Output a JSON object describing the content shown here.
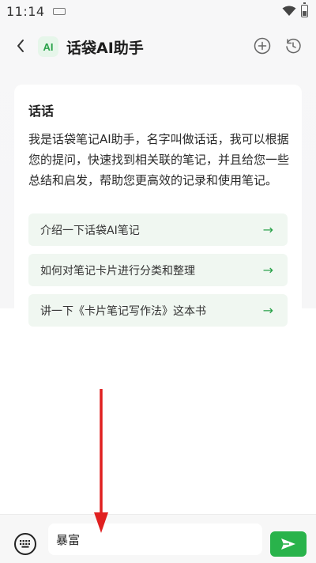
{
  "status_bar": {
    "time": "11:14"
  },
  "header": {
    "logo_text": "AI",
    "title": "话袋AI助手"
  },
  "card": {
    "title": "话话",
    "description": "我是话袋笔记AI助手，名字叫做话话，我可以根据您的提问，快速找到相关联的笔记，并且给您一些总结和启发，帮助您更高效的记录和使用笔记。",
    "suggestions": [
      {
        "label": "介绍一下话袋AI笔记",
        "arrow": "→"
      },
      {
        "label": "如何对笔记卡片进行分类和整理",
        "arrow": "→"
      },
      {
        "label": "讲一下《卡片笔记写作法》这本书",
        "arrow": "→"
      }
    ]
  },
  "input_bar": {
    "value": "暴富"
  },
  "colors": {
    "accent": "#29b34b",
    "suggestion_bg": "#f0f7f1",
    "annotation": "#e02020"
  }
}
